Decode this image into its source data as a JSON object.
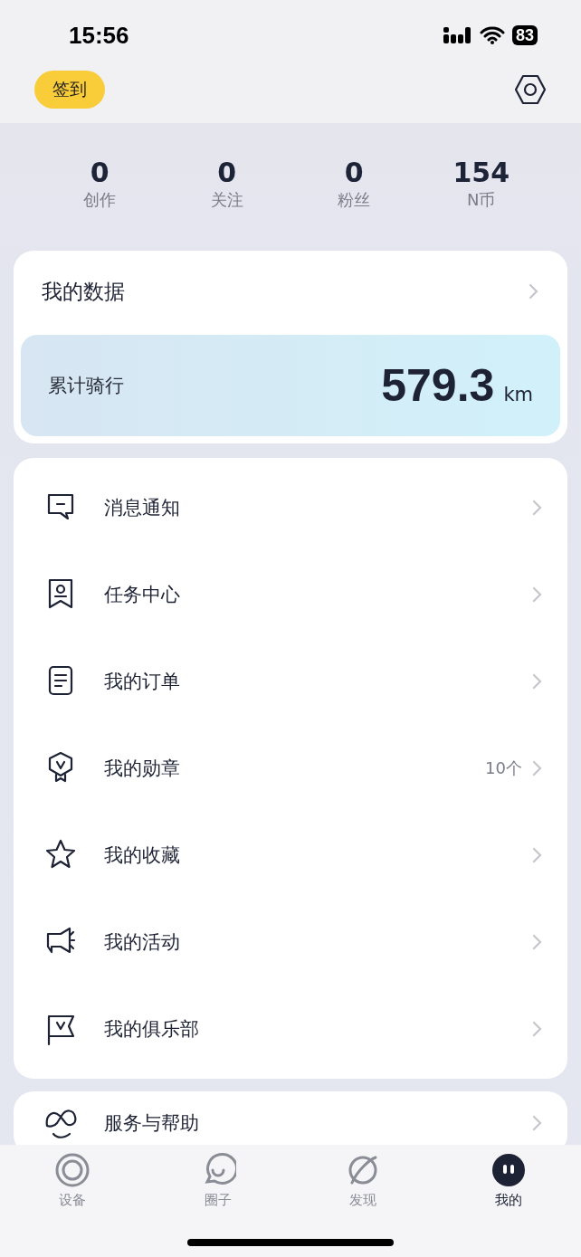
{
  "status_bar": {
    "time": "15:56",
    "battery": "83"
  },
  "header": {
    "checkin_button": "签到"
  },
  "stats": [
    {
      "value": "0",
      "label": "创作"
    },
    {
      "value": "0",
      "label": "关注"
    },
    {
      "value": "0",
      "label": "粉丝"
    },
    {
      "value": "154",
      "label": "N币"
    }
  ],
  "data_card": {
    "title": "我的数据",
    "ride_label": "累计骑行",
    "ride_value": "579.3",
    "ride_unit": "km"
  },
  "menu": [
    {
      "label": "消息通知"
    },
    {
      "label": "任务中心"
    },
    {
      "label": "我的订单"
    },
    {
      "label": "我的勋章",
      "count": "10个"
    },
    {
      "label": "我的收藏"
    },
    {
      "label": "我的活动"
    },
    {
      "label": "我的俱乐部"
    }
  ],
  "menu_2": [
    {
      "label": "服务与帮助"
    }
  ],
  "tab_bar": [
    {
      "label": "设备",
      "selected": false
    },
    {
      "label": "圈子",
      "selected": false
    },
    {
      "label": "发现",
      "selected": false
    },
    {
      "label": "我的",
      "selected": true
    }
  ]
}
